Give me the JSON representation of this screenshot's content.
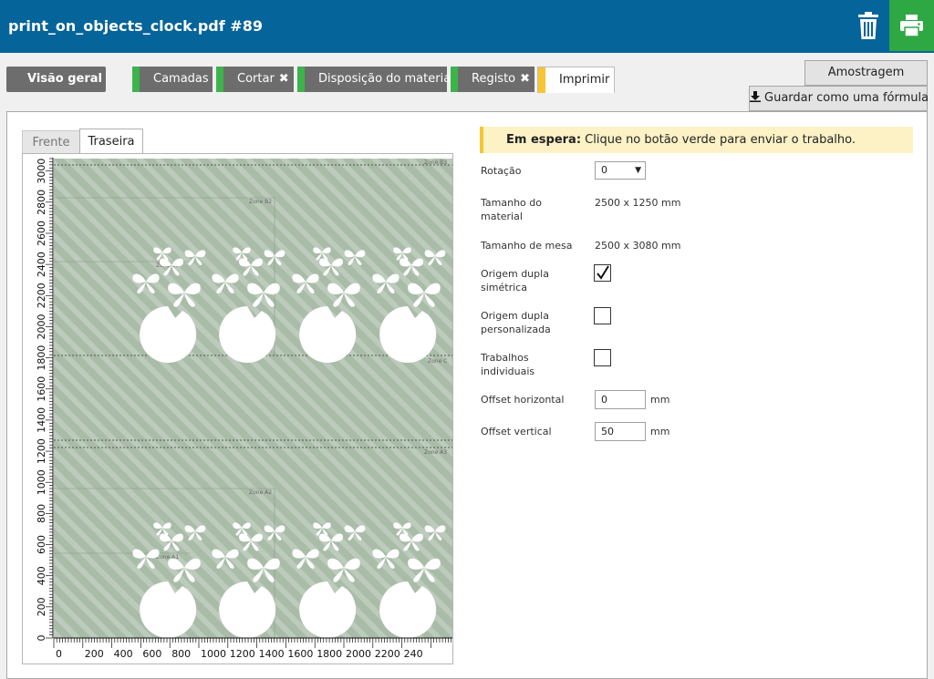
{
  "header": {
    "title": "print_on_objects_clock.pdf #89"
  },
  "icons": {
    "trash": "trash-icon",
    "print": "printer-icon",
    "download": "download-icon",
    "close": "close-icon"
  },
  "tabs": {
    "overview": "Visão geral",
    "layers": "Camadas",
    "cut": "Cortar",
    "media_layout": "Disposição do material",
    "register": "Registo",
    "print": "Imprimir"
  },
  "colors": {
    "header": "#05649a",
    "print_button": "#2ea843",
    "tab_done": "#3cb44b",
    "tab_current": "#f6c531"
  },
  "actions": {
    "sampling": "Amostragem",
    "save_formula": "Guardar como uma fórmula"
  },
  "side_tabs": {
    "front": "Frente",
    "back": "Traseira"
  },
  "preview": {
    "y_ticks": [
      "0",
      "200",
      "400",
      "600",
      "800",
      "1000",
      "1200",
      "1400",
      "1600",
      "1800",
      "2000",
      "2200",
      "2400",
      "2600",
      "2800",
      "3000"
    ],
    "x_ticks": [
      "0",
      "200",
      "400",
      "600",
      "800",
      "1000",
      "1200",
      "1400",
      "1600",
      "1800",
      "2000",
      "2200",
      "240"
    ],
    "zones": {
      "b3": "Zone B3",
      "b2": "Zone B2",
      "b1": "Zone B1",
      "c": "Zone C",
      "a3": "Zone A3",
      "a2": "Zone A2",
      "a1": "Zone A1"
    }
  },
  "status": {
    "label": "Em espera:",
    "message": " Clique no botão verde para enviar o trabalho."
  },
  "form": {
    "rotation_label": "Rotação",
    "rotation_value": "0",
    "media_size_label": "Tamanho do material",
    "media_size_value": "2500 x 1250 mm",
    "table_size_label": "Tamanho de mesa",
    "table_size_value": "2500 x 3080 mm",
    "dual_symmetric_label": "Origem dupla simétrica",
    "dual_custom_label": "Origem dupla personalizada",
    "individual_label": "Trabalhos individuais",
    "offset_h_label": "Offset horizontal",
    "offset_h_value": "0",
    "offset_v_label": "Offset vertical",
    "offset_v_value": "50",
    "unit": "mm"
  }
}
